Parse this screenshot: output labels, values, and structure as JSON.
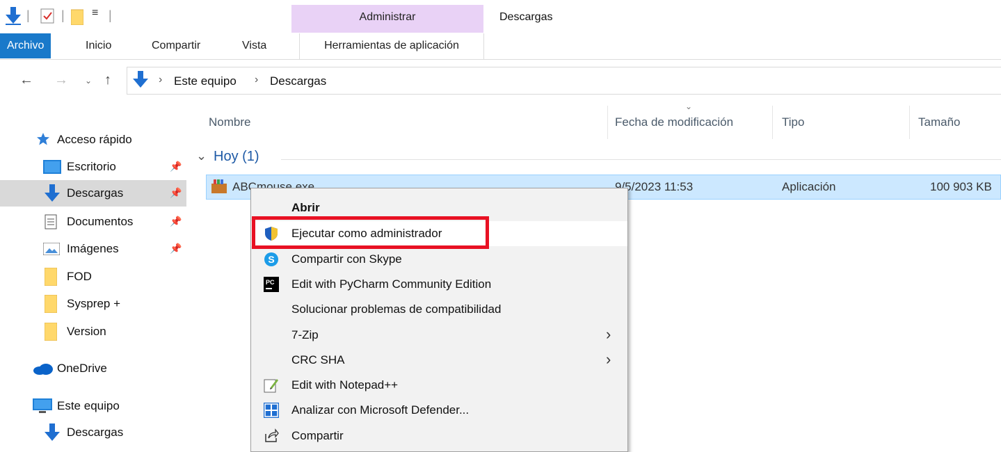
{
  "titlebar": {
    "manage_label": "Administrar",
    "window_title": "Descargas"
  },
  "ribbon": {
    "tabs": [
      {
        "label": "Archivo"
      },
      {
        "label": "Inicio"
      },
      {
        "label": "Compartir"
      },
      {
        "label": "Vista"
      }
    ],
    "context_tab": "Herramientas de aplicación"
  },
  "address": {
    "crumbs": [
      "Este equipo",
      "Descargas"
    ]
  },
  "sidebar": {
    "items": [
      {
        "label": "Acceso rápido"
      },
      {
        "label": "Escritorio"
      },
      {
        "label": "Descargas"
      },
      {
        "label": "Documentos"
      },
      {
        "label": "Imágenes"
      },
      {
        "label": "FOD"
      },
      {
        "label": "Sysprep +"
      },
      {
        "label": "Version"
      },
      {
        "label": "OneDrive"
      },
      {
        "label": "Este equipo"
      },
      {
        "label": "Descargas"
      }
    ]
  },
  "columns": {
    "name": "Nombre",
    "date": "Fecha de modificación",
    "type": "Tipo",
    "size": "Tamaño"
  },
  "group": {
    "title": "Hoy (1)"
  },
  "file": {
    "name": "ABCmouse.exe",
    "date": "9/5/2023 11:53",
    "type": "Aplicación",
    "size": "100 903 KB"
  },
  "context_menu": {
    "items": [
      {
        "label": "Abrir"
      },
      {
        "label": "Ejecutar como administrador"
      },
      {
        "label": "Compartir con Skype"
      },
      {
        "label": "Edit with PyCharm Community Edition"
      },
      {
        "label": "Solucionar problemas de compatibilidad"
      },
      {
        "label": "7-Zip"
      },
      {
        "label": "CRC SHA"
      },
      {
        "label": "Edit with Notepad++"
      },
      {
        "label": "Analizar con Microsoft Defender..."
      },
      {
        "label": "Compartir"
      }
    ]
  },
  "colors": {
    "file_tab": "#1979ca",
    "manage_group": "#e9d2f6",
    "selection": "#cce8ff",
    "highlight": "#e81123"
  }
}
